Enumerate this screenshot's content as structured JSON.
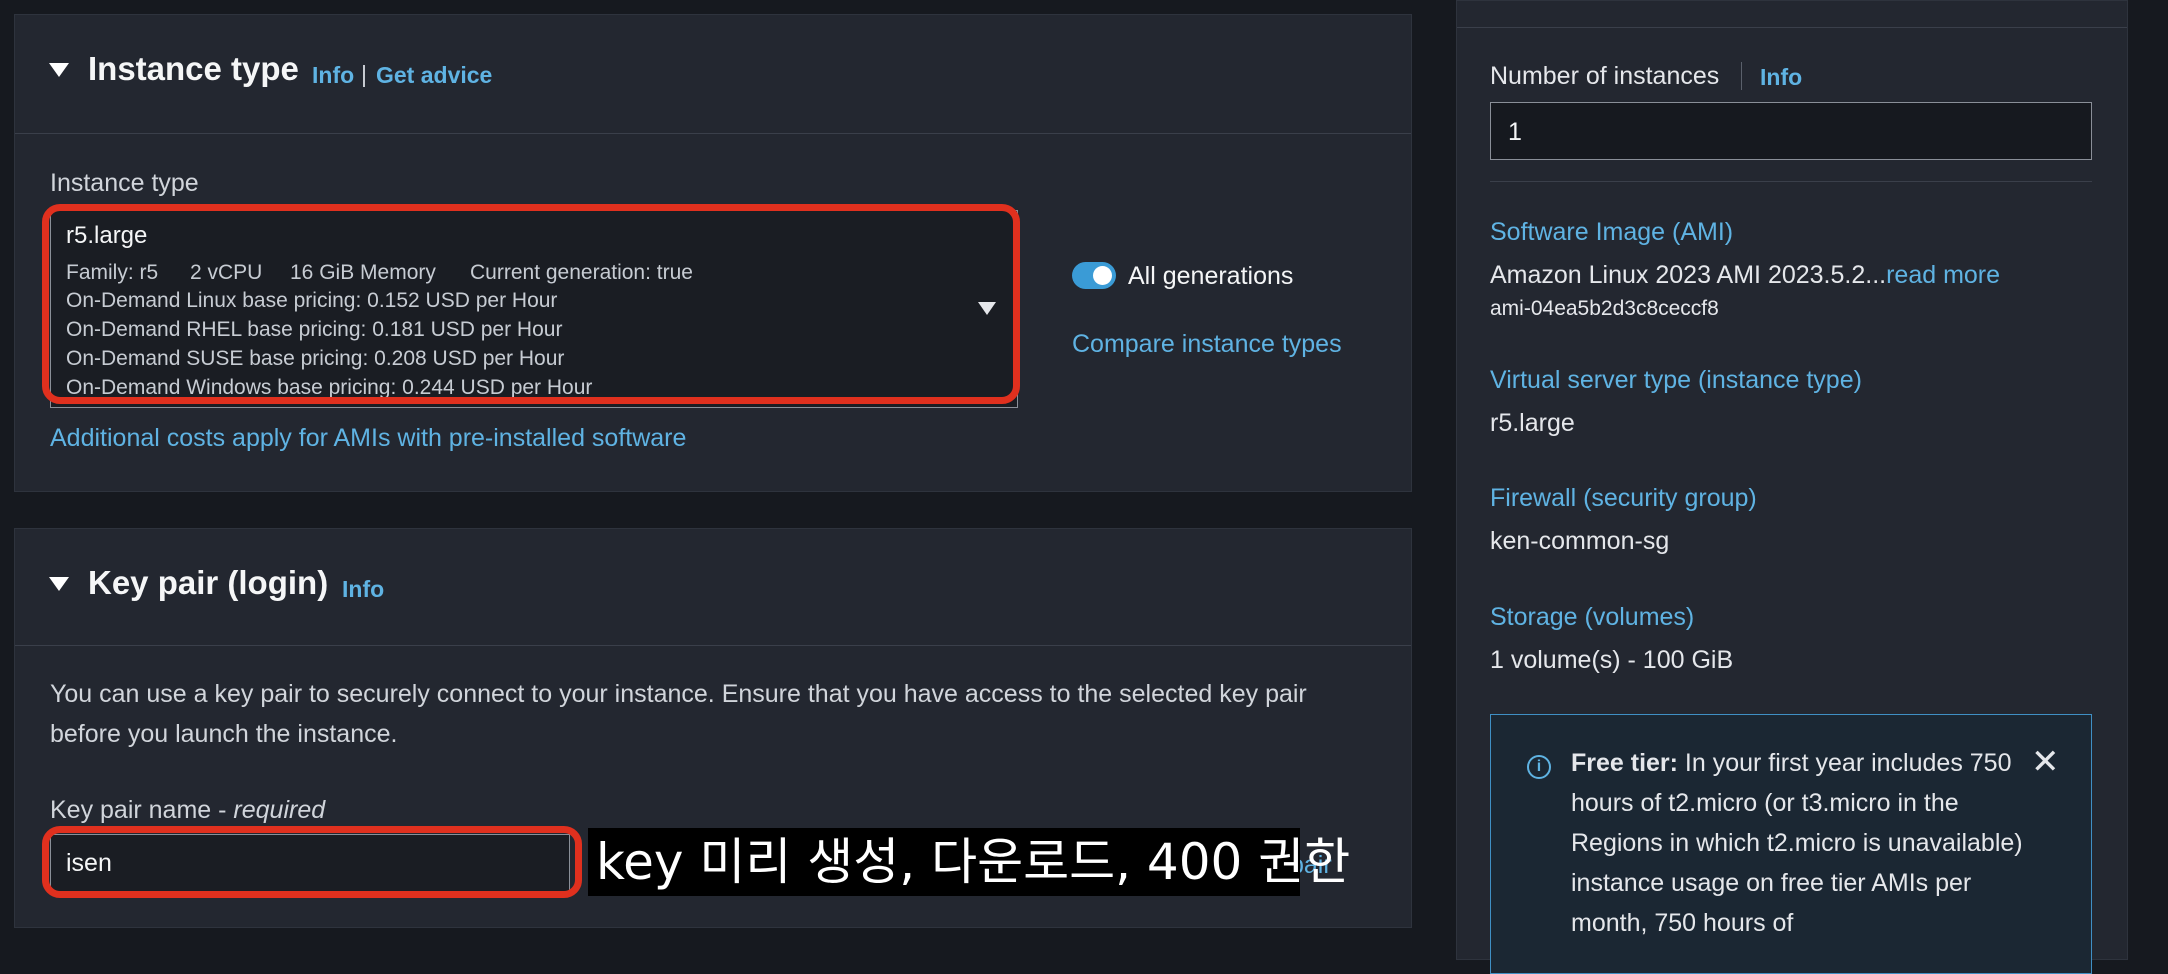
{
  "instance_type_section": {
    "title": "Instance type",
    "info_link": "Info",
    "separator": "|",
    "advice_link": "Get advice",
    "field_label": "Instance type",
    "selected": {
      "name": "r5.large",
      "family": "Family: r5",
      "vcpu": "2 vCPU",
      "memory": "16 GiB Memory",
      "generation": "Current generation: true",
      "pricing": [
        "On-Demand Linux base pricing: 0.152 USD per Hour",
        "On-Demand RHEL base pricing: 0.181 USD per Hour",
        "On-Demand SUSE base pricing: 0.208 USD per Hour",
        "On-Demand Windows base pricing: 0.244 USD per Hour"
      ]
    },
    "all_generations_label": "All generations",
    "all_generations_on": true,
    "compare_link": "Compare instance types",
    "additional_costs_link": "Additional costs apply for AMIs with pre-installed software"
  },
  "key_pair_section": {
    "title": "Key pair (login)",
    "info_link": "Info",
    "description": [
      "You can use a key pair to securely connect to your instance. Ensure that you have access to the selected key pair",
      "before you launch the instance."
    ],
    "field_label": "Key pair name - ",
    "field_required": "required",
    "selected_value": "isen",
    "create_link_partial": "pair"
  },
  "summary": {
    "num_instances_label": "Number of instances",
    "num_instances_info": "Info",
    "num_instances_value": "1",
    "ami_label": "Software Image (AMI)",
    "ami_value": "Amazon Linux 2023 AMI 2023.5.2...",
    "ami_read_more": "read more",
    "ami_id": "ami-04ea5b2d3c8ceccf8",
    "server_type_label": "Virtual server type (instance type)",
    "server_type_value": "r5.large",
    "firewall_label": "Firewall (security group)",
    "firewall_value": "ken-common-sg",
    "storage_label": "Storage (volumes)",
    "storage_value": "1 volume(s) - 100 GiB",
    "free_tier": {
      "bold": "Free tier:",
      "text": " In your first year includes 750 hours of t2.micro (or t3.micro in the Regions in which t2.micro is unavailable) instance usage on free tier AMIs per month, 750 hours of"
    }
  },
  "caption": "key 미리 생성, 다운로드, 400 권한",
  "colors": {
    "accent": "#5fb3e3",
    "highlight": "#e0301e",
    "panel": "#232730",
    "background": "#16191f"
  }
}
